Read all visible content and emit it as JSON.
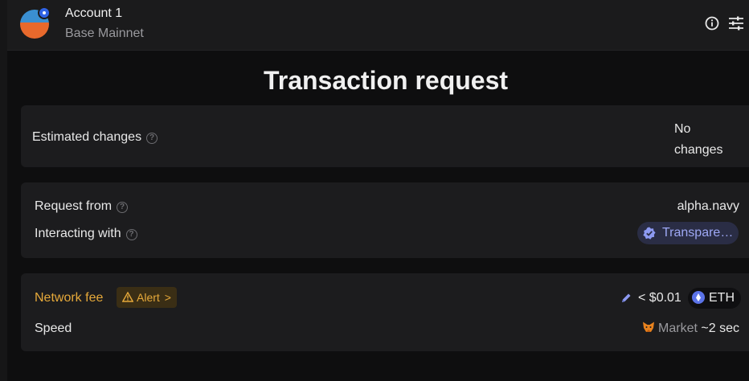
{
  "header": {
    "account_name": "Account 1",
    "network_name": "Base Mainnet"
  },
  "page_title": "Transaction request",
  "estimated_changes": {
    "label": "Estimated changes",
    "value_line1": "No",
    "value_line2": "changes"
  },
  "request": {
    "from_label": "Request from",
    "from_value": "alpha.navy",
    "interacting_label": "Interacting with",
    "interacting_value": "Transpare…"
  },
  "fee": {
    "label": "Network fee",
    "alert_label": "Alert",
    "alert_chevron": ">",
    "value": "< $0.01",
    "token": "ETH",
    "speed_label": "Speed",
    "speed_market": "Market",
    "speed_time": "~2 sec"
  },
  "help_glyph": "?",
  "colors": {
    "background": "#0e0e0f",
    "card": "#1c1c1e",
    "warning": "#e6a93a",
    "contract_text": "#9ea8f5",
    "eth_blue": "#5b73e8"
  },
  "icons": [
    "info-icon",
    "settings-sliders-icon",
    "help-icon",
    "verified-badge-icon",
    "warning-triangle-icon",
    "chevron-right-icon",
    "pencil-edit-icon",
    "eth-icon",
    "metamask-fox-icon"
  ]
}
